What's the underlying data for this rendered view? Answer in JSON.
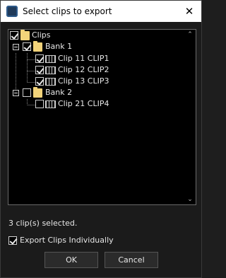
{
  "window": {
    "title": "Select clips to export",
    "close_glyph": "✕"
  },
  "tree": {
    "root": {
      "label": "Clips",
      "checked": true
    },
    "banks": [
      {
        "label": "Bank 1",
        "checked": true,
        "clips": [
          {
            "label": "Clip 11 CLIP1",
            "checked": true
          },
          {
            "label": "Clip 12 CLIP2",
            "checked": true
          },
          {
            "label": "Clip 13 CLIP3",
            "checked": true
          }
        ]
      },
      {
        "label": "Bank 2",
        "checked": false,
        "clips": [
          {
            "label": "Clip 21 CLIP4",
            "checked": false
          }
        ]
      }
    ],
    "scroll_up_glyph": "⌃",
    "scroll_down_glyph": "⌄"
  },
  "status": {
    "text": "3 clip(s) selected."
  },
  "export": {
    "label": "Export Clips Individually",
    "checked": true
  },
  "buttons": {
    "ok": "OK",
    "cancel": "Cancel"
  },
  "icons": {
    "app": "app-icon",
    "folder": "folder-icon",
    "clip": "film-clip-icon"
  }
}
